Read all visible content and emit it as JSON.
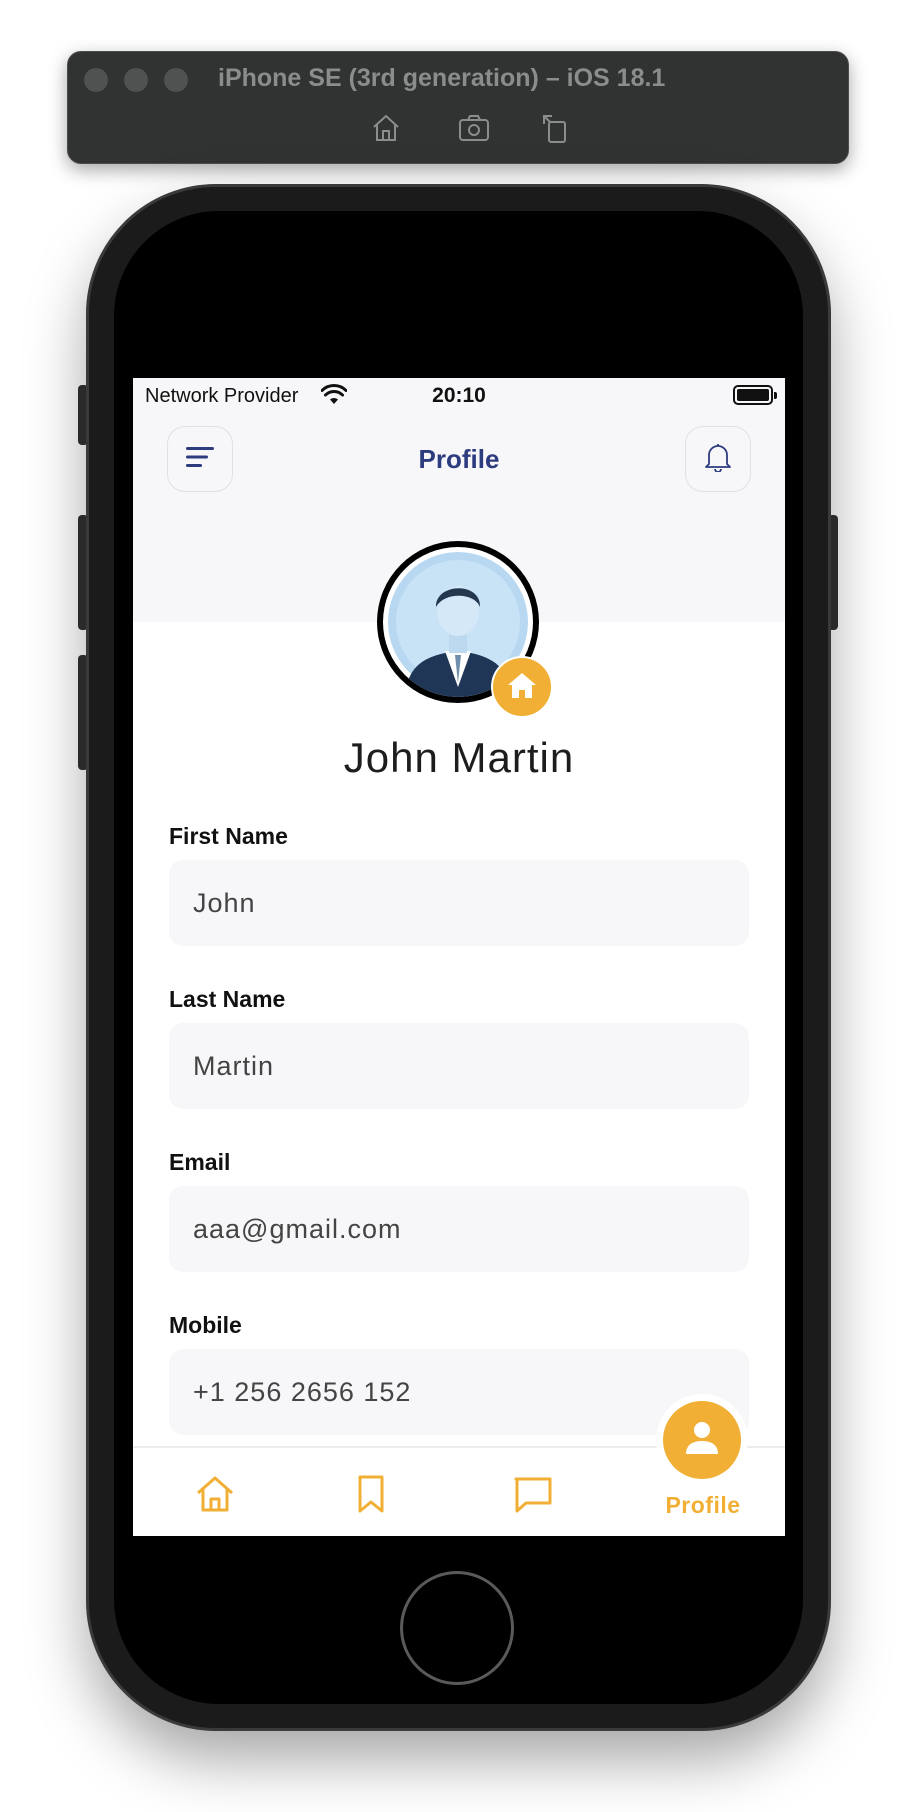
{
  "simulator": {
    "title": "iPhone SE (3rd generation) – iOS 18.1",
    "toolbar": [
      "home-icon",
      "screenshot-icon",
      "rotate-icon"
    ]
  },
  "status_bar": {
    "carrier": "Network Provider",
    "time": "20:10"
  },
  "header": {
    "title": "Profile",
    "left_icon": "menu-icon",
    "right_icon": "bell-icon"
  },
  "profile": {
    "name": "John Martin",
    "badge_icon": "home-icon"
  },
  "fields": [
    {
      "label": "First Name",
      "value": "John"
    },
    {
      "label": "Last Name",
      "value": "Martin"
    },
    {
      "label": "Email",
      "value": "aaa@gmail.com"
    },
    {
      "label": "Mobile",
      "value": "+1 256 2656 152"
    }
  ],
  "tabbar": {
    "active_label": "Profile",
    "items": [
      "home-icon",
      "bookmark-icon",
      "chat-icon",
      "person-icon"
    ]
  },
  "colors": {
    "accent": "#f1b035",
    "title": "#2d3b7f",
    "field_bg": "#f7f7f9"
  }
}
